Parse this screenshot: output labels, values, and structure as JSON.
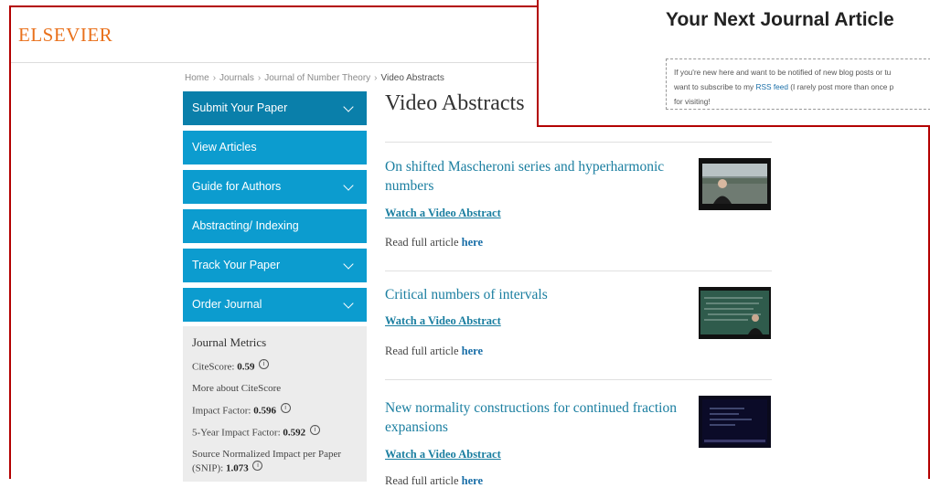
{
  "brand": {
    "name": "ELSEVIER"
  },
  "breadcrumb": {
    "home": "Home",
    "journals": "Journals",
    "journal": "Journal of Number Theory",
    "current": "Video Abstracts"
  },
  "nav": {
    "submit": "Submit Your Paper",
    "view": "View Articles",
    "guide": "Guide for Authors",
    "abstracting": "Abstracting/ Indexing",
    "track": "Track Your Paper",
    "order": "Order Journal"
  },
  "metrics": {
    "title": "Journal Metrics",
    "citescore_label": "CiteScore:",
    "citescore_value": "0.59",
    "more": "More about CiteScore",
    "if_label": "Impact Factor:",
    "if_value": "0.596",
    "if5_label": "5-Year Impact Factor:",
    "if5_value": "0.592",
    "snip_label": "Source Normalized Impact per Paper (SNIP):",
    "snip_value": "1.073"
  },
  "page": {
    "title": "Video Abstracts"
  },
  "articles": [
    {
      "title": "On shifted Mascheroni series and hyperharmonic numbers",
      "watch": "Watch a Video Abstract",
      "read": "Read full article",
      "here": "here"
    },
    {
      "title": "Critical numbers of intervals",
      "watch": "Watch a Video Abstract",
      "read": "Read full article",
      "here": "here"
    },
    {
      "title": "New normality constructions for continued fraction expansions",
      "watch": "Watch a Video Abstract",
      "read": "Read full article",
      "here": "here"
    }
  ],
  "popup": {
    "title": "Your Next Journal Article",
    "line1": "If you're new here and want to be notified of new blog posts or tu",
    "line2_pre": "want to subscribe to my",
    "rss": "RSS feed",
    "line2_post": "(I rarely post more than once p",
    "line3": "for visiting!"
  },
  "colors": {
    "brand": "#e9711c",
    "nav": "#0c9ccf",
    "nav_active": "#0a7faa",
    "link": "#1a7ea0",
    "frame": "#b30000"
  }
}
